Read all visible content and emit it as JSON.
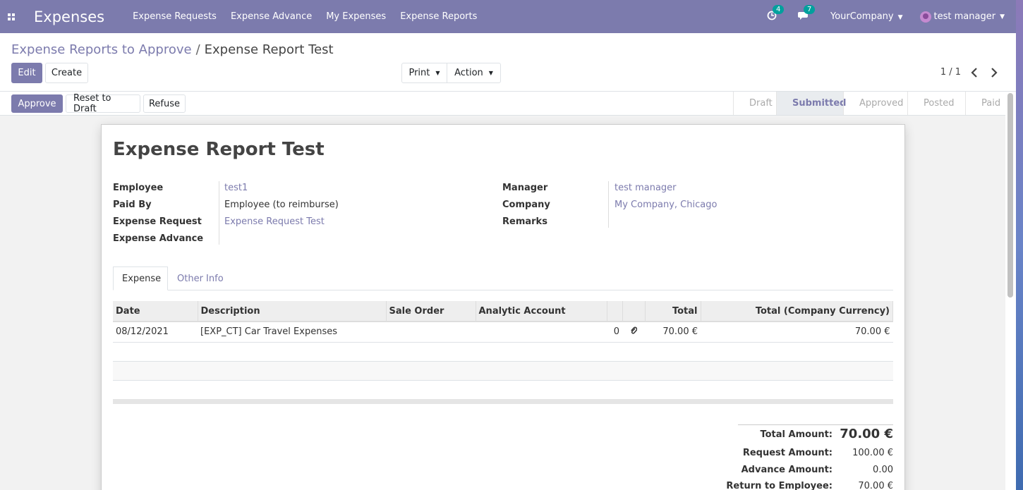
{
  "navbar": {
    "app_title": "Expenses",
    "menu": [
      "Expense Requests",
      "Expense Advance",
      "My Expenses",
      "Expense Reports"
    ],
    "activity_count": "4",
    "message_count": "7",
    "company": "YourCompany",
    "user": "test manager"
  },
  "breadcrumb": {
    "parent": "Expense Reports to Approve",
    "separator": "/",
    "current": "Expense Report Test"
  },
  "control": {
    "edit": "Edit",
    "create": "Create",
    "print": "Print",
    "action": "Action",
    "pager": "1 / 1"
  },
  "statusbar": {
    "buttons": [
      "Approve",
      "Reset to Draft",
      "Refuse"
    ],
    "steps": [
      "Draft",
      "Submitted",
      "Approved",
      "Posted",
      "Paid"
    ],
    "active_step": "Submitted"
  },
  "form": {
    "title": "Expense Report Test",
    "left_fields": [
      {
        "label": "Employee",
        "value": "test1",
        "link": true
      },
      {
        "label": "Paid By",
        "value": "Employee (to reimburse)",
        "link": false
      },
      {
        "label": "Expense Request",
        "value": "Expense Request Test",
        "link": true
      },
      {
        "label": "Expense Advance",
        "value": "",
        "link": false
      }
    ],
    "right_fields": [
      {
        "label": "Manager",
        "value": "test manager",
        "link": true
      },
      {
        "label": "Company",
        "value": "My Company, Chicago",
        "link": true
      },
      {
        "label": "Remarks",
        "value": "",
        "link": false
      }
    ],
    "tabs": [
      "Expense",
      "Other Info"
    ],
    "table": {
      "headers": [
        "Date",
        "Description",
        "Sale Order",
        "Analytic Account",
        "",
        "",
        "Total",
        "Total (Company Currency)"
      ],
      "rows": [
        {
          "date": "08/12/2021",
          "description": "[EXP_CT] Car Travel Expenses",
          "sale_order": "",
          "analytic": "",
          "attachments": "0",
          "total": "70.00 €",
          "total_company": "70.00 €"
        }
      ]
    },
    "totals": [
      {
        "label": "Total Amount:",
        "value": "70.00 €"
      },
      {
        "label": "Request Amount:",
        "value": "100.00 €"
      },
      {
        "label": "Advance Amount:",
        "value": "0.00"
      },
      {
        "label": "Return to Employee:",
        "value": "70.00 €"
      }
    ]
  },
  "colors": {
    "brand": "#7c7bad",
    "badge": "#00a09d"
  }
}
